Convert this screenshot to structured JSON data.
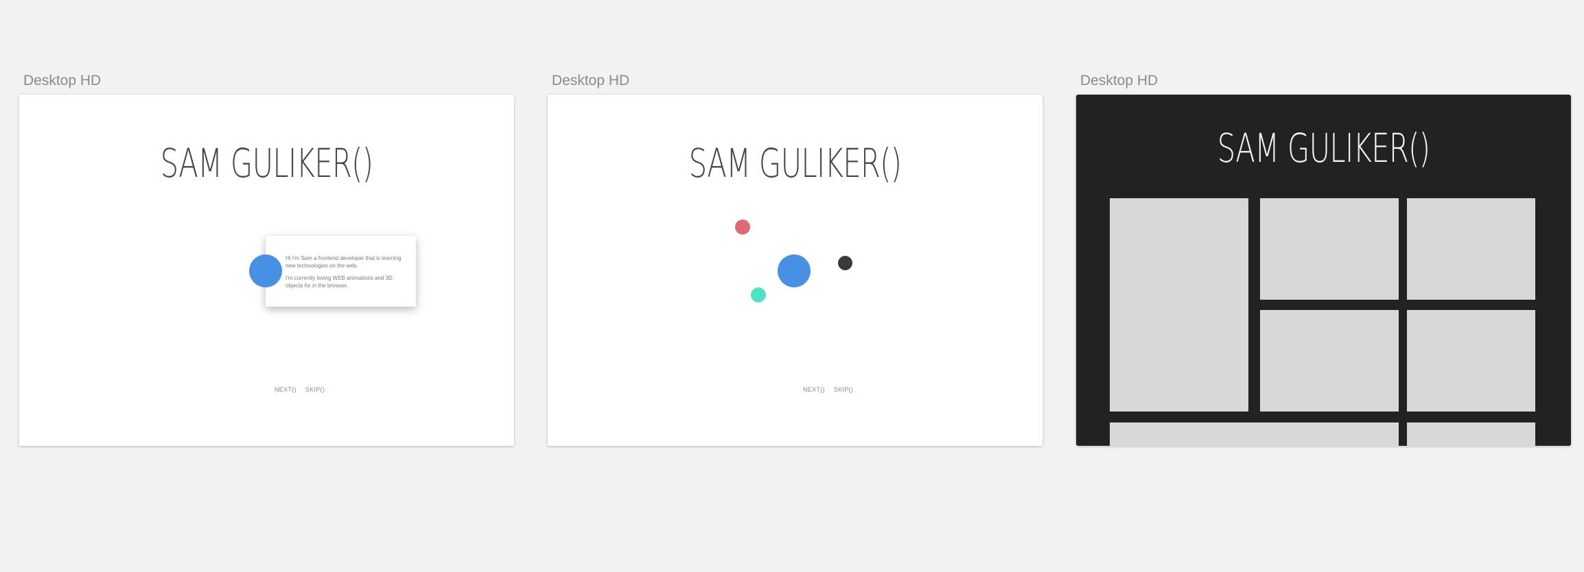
{
  "artboards": [
    {
      "label": "Desktop HD",
      "title": "SAM GULIKER()",
      "card": {
        "paragraph_1": "Hi I'm Sam a frontend developer that is learning new technologies on the web.",
        "paragraph_2": "I'm currently loving WEB animations and 3D objects for in the browser."
      },
      "nav": {
        "next": "NEXT()",
        "skip": "SKIP()"
      },
      "colors": {
        "avatar": "#4a90e2"
      }
    },
    {
      "label": "Desktop HD",
      "title": "SAM GULIKER()",
      "nav": {
        "next": "NEXT()",
        "skip": "SKIP()"
      },
      "colors": {
        "center": "#4a90e2",
        "red": "#e06a74",
        "dark": "#3a3a3a",
        "teal": "#50e3c2"
      }
    },
    {
      "label": "Desktop HD",
      "title": "SAM GULIKER()",
      "colors": {
        "background": "#222222",
        "tile": "#d8d8d8"
      }
    }
  ]
}
